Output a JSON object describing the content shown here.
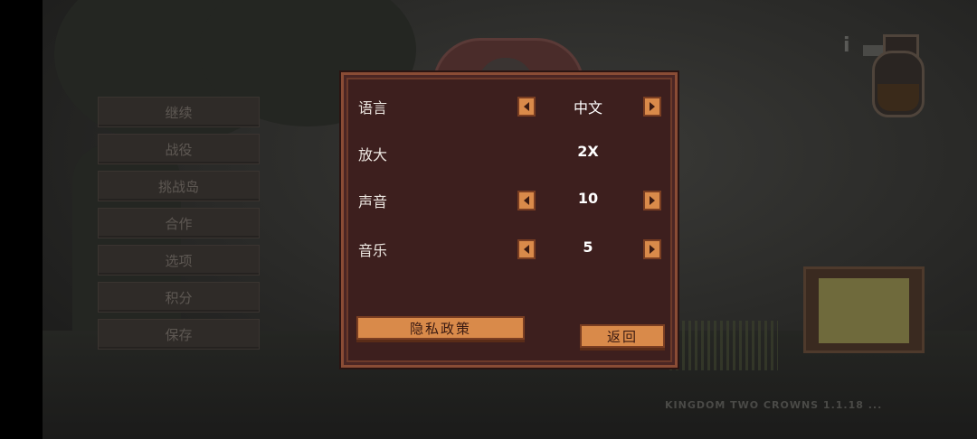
{
  "menu": {
    "items": [
      {
        "label": "继续"
      },
      {
        "label": "战役"
      },
      {
        "label": "挑战岛"
      },
      {
        "label": "合作"
      },
      {
        "label": "选项"
      },
      {
        "label": "积分"
      },
      {
        "label": "保存"
      }
    ]
  },
  "options": {
    "language": {
      "label": "语言",
      "value": "中文"
    },
    "zoom": {
      "label": "放大",
      "value": "2X"
    },
    "sound": {
      "label": "声音",
      "value": "10"
    },
    "music": {
      "label": "音乐",
      "value": "5"
    },
    "privacy_label": "隐私政策",
    "back_label": "返回"
  },
  "hud": {
    "info_glyph": "i",
    "watermark": "KINGDOM TWO CROWNS 1.1.18 ..."
  },
  "colors": {
    "dialog_bg": "#3d1f1e",
    "button_orange": "#d98a4a",
    "border_brown": "#8a4c35"
  }
}
